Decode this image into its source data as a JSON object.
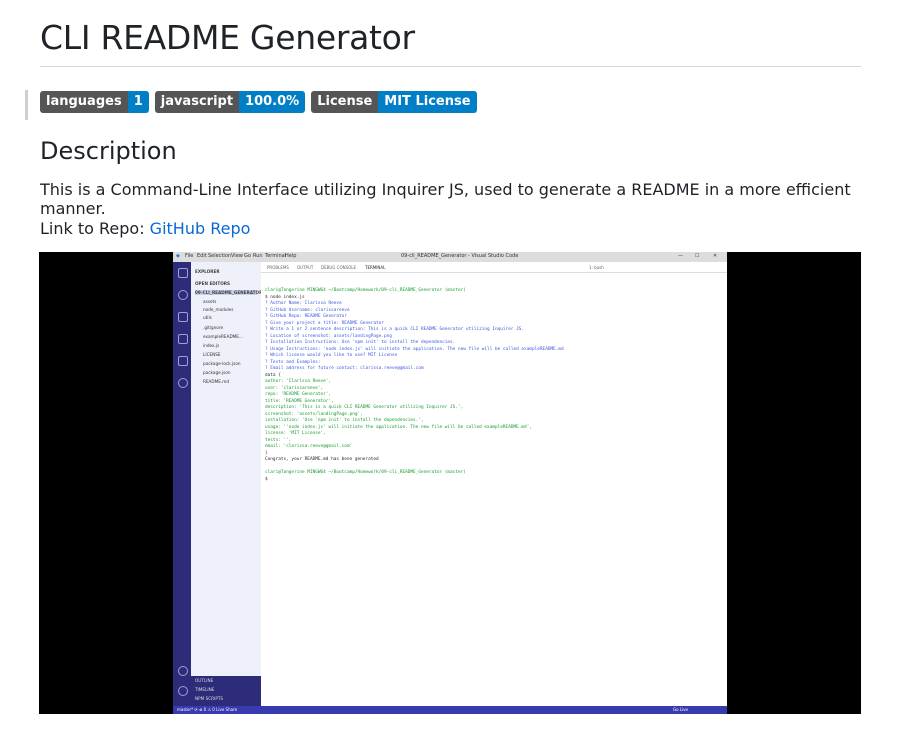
{
  "page": {
    "title": "CLI README Generator",
    "badges": [
      {
        "key": "languages",
        "value": "1"
      },
      {
        "key": "javascript",
        "value": "100.0%"
      },
      {
        "key": "License",
        "value": "MIT License"
      }
    ],
    "description_heading": "Description",
    "description_text": "This is a Command-Line Interface utilizing Inquirer JS, used to generate a README in a more efficient manner.",
    "link_prefix": "Link to Repo: ",
    "link_text": "GitHub Repo"
  },
  "screenshot": {
    "menu": [
      "File",
      "Edit",
      "Selection",
      "View",
      "Go",
      "Run",
      "Terminal",
      "Help"
    ],
    "window_title": "09-cli_README_Generator - Visual Studio Code",
    "explorer": {
      "header": "EXPLORER",
      "open_editors": "OPEN EDITORS",
      "folder": "09-CLI_README_GENERATOR",
      "items": [
        "assets",
        "node_modules",
        "utils",
        ".gitignore",
        "exampleREADME...",
        "index.js",
        "LICENSE",
        "package-lock.json",
        "package.json",
        "README.md"
      ],
      "bottom": [
        "OUTLINE",
        "TIMELINE",
        "NPM SCRIPTS"
      ]
    },
    "panel_tabs": [
      "PROBLEMS",
      "OUTPUT",
      "DEBUG CONSOLE",
      "TERMINAL"
    ],
    "shell": "1: bash",
    "terminal_lines": [
      {
        "text": "clari@Tangerine MINGW64 ~/Bootcamp/Homework/09-cli_README_Generator (master)",
        "tone": "green"
      },
      {
        "text": "$ node index.js",
        "tone": "plain"
      },
      {
        "text": "? Author Name: Clarissa Reeve",
        "tone": "blue"
      },
      {
        "text": "? GitHub Username: clarissareeve",
        "tone": "blue"
      },
      {
        "text": "? GitHub Repo: README Generator",
        "tone": "blue"
      },
      {
        "text": "? Give your project a title: README Generator",
        "tone": "blue"
      },
      {
        "text": "? Write a 1 or 2 sentence description: This is a quick CLI README Generator utilizing Inquirer JS.",
        "tone": "blue"
      },
      {
        "text": "? Location of screenshot: assets/landingPage.png",
        "tone": "blue"
      },
      {
        "text": "? Installation Instructions: Use 'npm init' to install the dependencies.",
        "tone": "blue"
      },
      {
        "text": "? Usage Instructions: 'node index.js' will initiate the application. The new file will be called exampleREADME.md",
        "tone": "blue"
      },
      {
        "text": "? Which license would you like to use? MIT License",
        "tone": "blue"
      },
      {
        "text": "? Tests and Examples:",
        "tone": "blue"
      },
      {
        "text": "? Email address for future contact: clarissa.reeve@gmail.com",
        "tone": "blue"
      },
      {
        "text": "data {",
        "tone": "plain"
      },
      {
        "text": "  author: 'Clarissa Reeve',",
        "tone": "green"
      },
      {
        "text": "  user: 'clarissareeve',",
        "tone": "green"
      },
      {
        "text": "  repo: 'README Generator',",
        "tone": "green"
      },
      {
        "text": "  title: 'README Generator',",
        "tone": "green"
      },
      {
        "text": "  description: 'This is a quick CLI README Generator utilizing Inquirer JS.',",
        "tone": "green"
      },
      {
        "text": "  screenshot: 'assets/landingPage.png',",
        "tone": "green"
      },
      {
        "text": "  installation: 'Use 'npm init' to install the dependencies.',",
        "tone": "green"
      },
      {
        "text": "  usage: ''node index.js' will initiate the application. The new file will be called exampleREADME.md',",
        "tone": "green"
      },
      {
        "text": "  license: 'MIT License',",
        "tone": "green"
      },
      {
        "text": "  tests: '',",
        "tone": "green"
      },
      {
        "text": "  email: 'clarissa.reeve@gmail.com'",
        "tone": "green"
      },
      {
        "text": "}",
        "tone": "plain"
      },
      {
        "text": "Congrats, your README.md has been generated",
        "tone": "plain"
      },
      {
        "text": "",
        "tone": "plain"
      },
      {
        "text": "clari@Tangerine MINGW64 ~/Bootcamp/Homework/09-cli_README_Generator (master)",
        "tone": "green"
      },
      {
        "text": "$",
        "tone": "plain"
      }
    ],
    "status_left": "master*  ⟳  ⊗ 0 ⚠ 0   Live Share",
    "status_right": "Go Live"
  },
  "colors": {
    "badge_key": "#555555",
    "badge_value": "#007ec6",
    "link": "#0969da",
    "vscode_activity": "#2c2c7a",
    "vscode_status": "#3a3ab0"
  }
}
